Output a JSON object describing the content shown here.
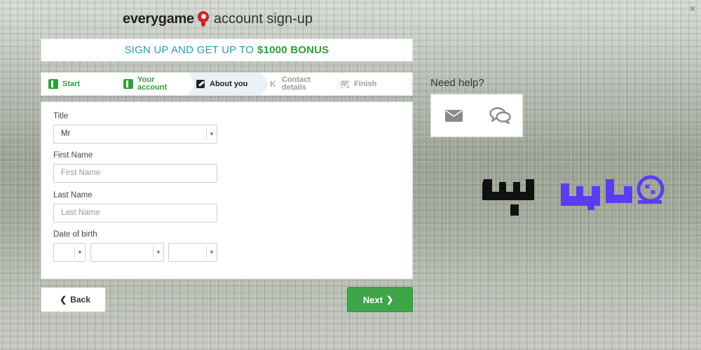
{
  "brand": {
    "name": "everygame",
    "subtitle": "account sign-up"
  },
  "close_label": "×",
  "bonus": {
    "prefix": "SIGN UP AND GET UP TO",
    "amount": "$1000 BONUS"
  },
  "steps": [
    {
      "label": "Start",
      "state": "done"
    },
    {
      "label_line1": "Your",
      "label_line2": "account",
      "state": "done"
    },
    {
      "label": "About you",
      "state": "current"
    },
    {
      "label_line1": "Contact",
      "label_line2": "details",
      "state": "upcoming"
    },
    {
      "label": "Finish",
      "state": "upcoming"
    }
  ],
  "form": {
    "title_label": "Title",
    "title_value": "Mr",
    "first_name_label": "First Name",
    "first_name_placeholder": "First Name",
    "last_name_label": "Last Name",
    "last_name_placeholder": "Last Name",
    "dob_label": "Date of birth"
  },
  "buttons": {
    "back": "Back",
    "next": "Next"
  },
  "help": {
    "title": "Need help?",
    "icons": [
      "mail-icon",
      "chat-icon"
    ]
  },
  "colors": {
    "green": "#3ea548",
    "teal": "#2a9bb0",
    "brand_red": "#d8232a",
    "watermark_purple": "#5b3cf0"
  }
}
